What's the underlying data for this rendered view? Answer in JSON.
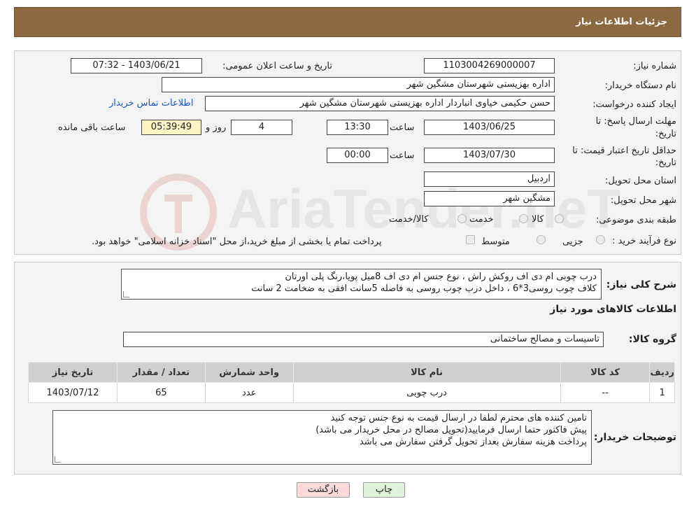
{
  "header": {
    "title": "جزئیات اطلاعات نیاز"
  },
  "form": {
    "need_number_label": "شماره نیاز:",
    "need_number": "1103004269000007",
    "announce_label": "تاریخ و ساعت اعلان عمومی:",
    "announce_value": "1403/06/21 - 07:32",
    "buyer_org_label": "نام دستگاه خریدار:",
    "buyer_org": "اداره بهزیستی شهرستان مشگین شهر",
    "creator_label": "ایجاد کننده درخواست:",
    "creator": "حسن حکیمی خیاوی انباردار اداره بهزیستی شهرستان مشگین شهر",
    "contact_link": "اطلاعات تماس خریدار",
    "reply_deadline_label": "مهلت ارسال پاسخ: تا",
    "reply_deadline_label2": "تاریخ:",
    "reply_date": "1403/06/25",
    "time_label": "ساعت",
    "reply_time": "13:30",
    "days_value": "4",
    "days_label": "روز و",
    "remaining_time": "05:39:49",
    "remaining_label": "ساعت باقی مانده",
    "validity_label": "حداقل تاریخ اعتبار قیمت: تا",
    "validity_label2": "تاریخ:",
    "validity_date": "1403/07/30",
    "validity_time": "00:00",
    "province_label": "استان محل تحویل:",
    "province": "اردبیل",
    "city_label": "شهر محل تحویل:",
    "city": "مشگین شهر",
    "category_label": "طبقه بندی موضوعی:",
    "category_options": [
      "کالا",
      "خدمت",
      "کالا/خدمت"
    ],
    "process_label": "نوع فرآیند خرید :",
    "process_options": [
      "جزیی",
      "متوسط"
    ],
    "process_note": "پرداخت تمام یا بخشی از مبلغ خرید،از محل \"اسناد خزانه اسلامی\" خواهد بود."
  },
  "details": {
    "summary_label": "شرح کلی نیاز:",
    "summary_lines": [
      "درب چوبی ام دی اف روکش راش ، نوع جنس ام دی اف 8میل پویا،رنگ پلی اورتان",
      "کلاف چوب روسی3*6 ، داخل درب چوب روسی به فاصله 5سانت افقی به ضخامت 2 سانت"
    ],
    "goods_info_title": "اطلاعات کالاهای مورد نیاز",
    "goods_group_label": "گروه کالا:",
    "goods_group": "تاسیسات و مصالح ساختمانی",
    "table_headers": [
      "ردیف",
      "کد کالا",
      "نام کالا",
      "واحد شمارش",
      "تعداد / مقدار",
      "تاریخ نیاز"
    ],
    "table_rows": [
      [
        "1",
        "--",
        "درب چوبی",
        "عدد",
        "65",
        "1403/07/12"
      ]
    ],
    "buyer_notes_label": "توضیحات خریدار:",
    "buyer_notes_lines": [
      "تامین کننده های محترم لطفا در ارسال قیمت به نوع جنس توجه کنید",
      "پیش فاکتور حتما ارسال فرمایید(تحویل مصالح در محل خریدار می باشد)",
      "پرداخت هزینه سفارش بعداز تحویل گرفتن سفارش می باشد"
    ]
  },
  "buttons": {
    "print": "چاپ",
    "back": "بازگشت"
  },
  "watermark": {
    "text": "AriaTender.neT"
  },
  "colors": {
    "header_bg": "#8b6a42",
    "link": "#1a55c5",
    "back_btn_bg": "#f8d8d8",
    "print_btn_bg": "#e2f3dc"
  }
}
